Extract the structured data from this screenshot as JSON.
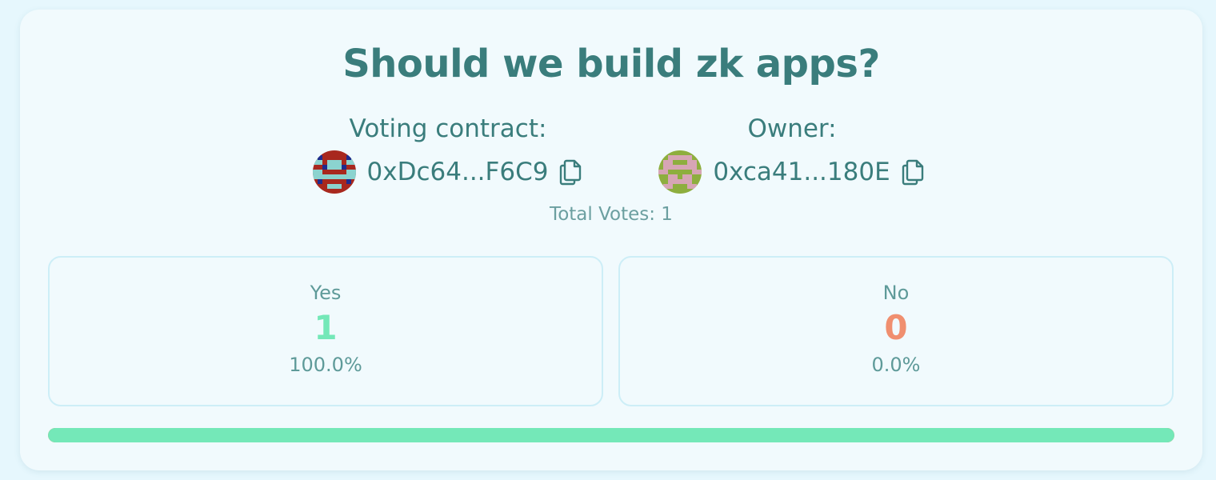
{
  "poll": {
    "title": "Should we build zk apps?",
    "total_votes_text": "Total Votes: 1"
  },
  "contract": {
    "label": "Voting contract:",
    "address": "0xDc64...F6C9",
    "avatar_icon": "identicon-avatar",
    "copy_icon": "copy-icon"
  },
  "owner": {
    "label": "Owner:",
    "address": "0xca41...180E",
    "avatar_icon": "identicon-avatar",
    "copy_icon": "copy-icon"
  },
  "options": {
    "yes": {
      "label": "Yes",
      "count": "1",
      "percent": "100.0%",
      "color": "#74e8b8"
    },
    "no": {
      "label": "No",
      "count": "0",
      "percent": "0.0%",
      "color": "#f08f6f"
    }
  },
  "progress": {
    "yes_fraction": 1.0,
    "yes_color": "#74e8b8",
    "no_color": "#f08f6f"
  },
  "colors": {
    "primary_text": "#3a7d7c",
    "muted_text": "#6b9fa0",
    "card_bg": "#f1fafd",
    "page_bg": "#e6f7fd"
  }
}
